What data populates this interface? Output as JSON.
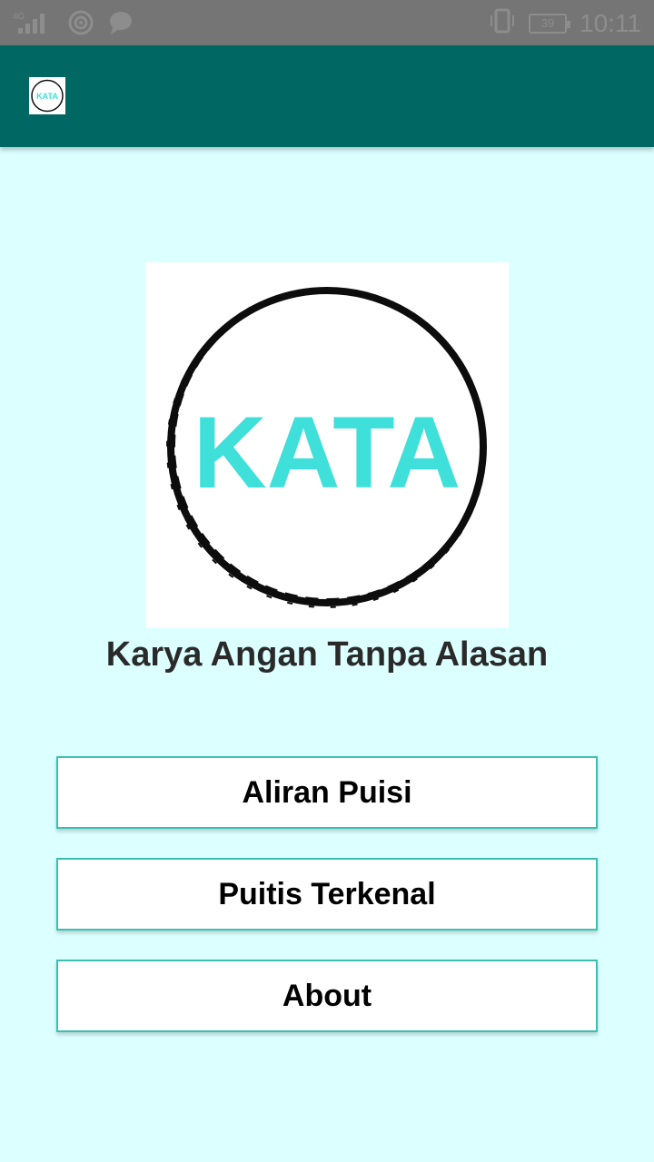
{
  "status_bar": {
    "network": "4G",
    "battery": "39",
    "time": "10:11",
    "icons": [
      "signal-icon",
      "hotspot-icon",
      "chat-icon",
      "vibrate-icon",
      "battery-icon"
    ]
  },
  "app_bar": {
    "logo_text": "KATA"
  },
  "main": {
    "logo_text": "KATA",
    "tagline": "Karya Angan Tanpa Alasan",
    "buttons": [
      {
        "label": "Aliran Puisi"
      },
      {
        "label": "Puitis Terkenal"
      },
      {
        "label": "About"
      }
    ]
  },
  "colors": {
    "app_bar": "#006763",
    "background": "#dcffff",
    "accent": "#3bbfb3",
    "logo_text": "#3fe0d9"
  }
}
